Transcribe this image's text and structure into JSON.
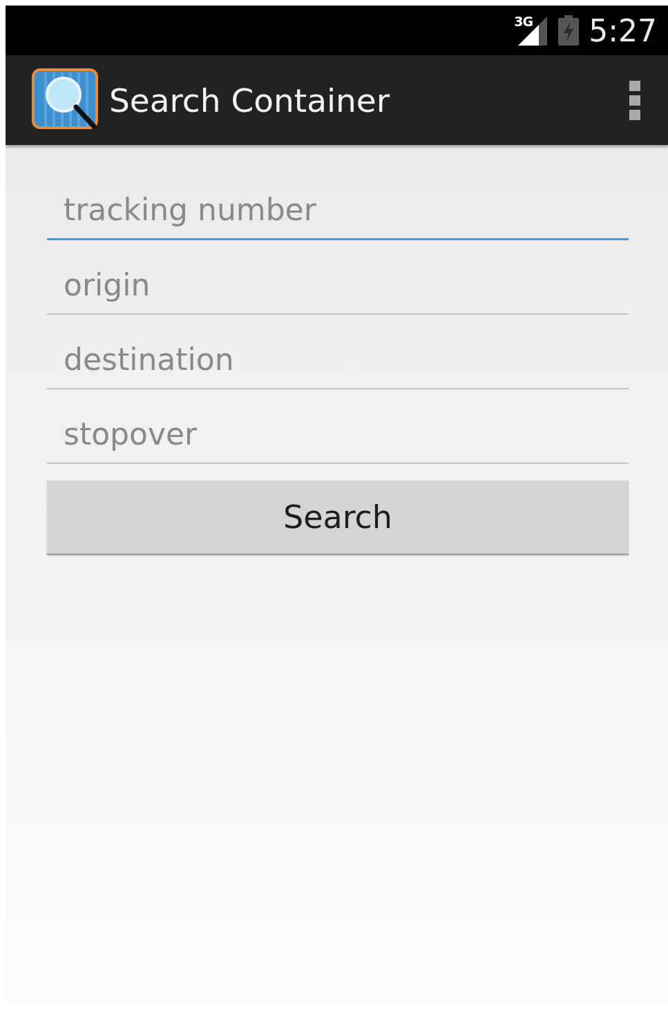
{
  "status_bar": {
    "network": "3G",
    "time": "5:27"
  },
  "action_bar": {
    "title": "Search Container"
  },
  "fields": [
    {
      "placeholder": "tracking number",
      "focused": true
    },
    {
      "placeholder": "origin",
      "focused": false
    },
    {
      "placeholder": "destination",
      "focused": false
    },
    {
      "placeholder": "stopover",
      "focused": false
    }
  ],
  "button": {
    "label": "Search"
  }
}
